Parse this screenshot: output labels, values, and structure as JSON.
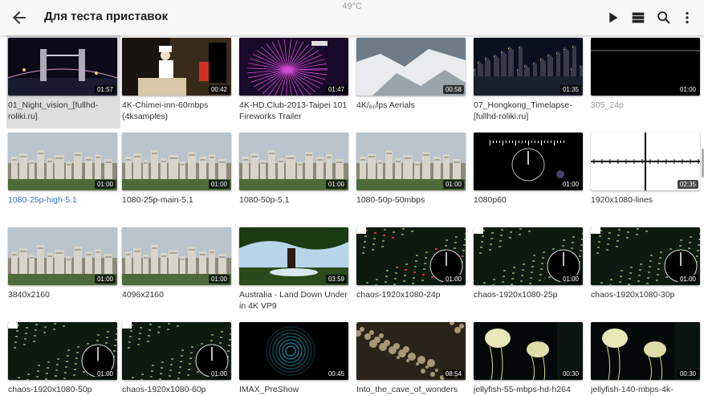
{
  "status_bar": {
    "temperature": "49°C"
  },
  "appbar": {
    "title": "Для теста приставок",
    "back_icon": "arrow-back-icon",
    "actions": [
      "play-icon",
      "list-view-icon",
      "search-icon",
      "more-vert-icon"
    ]
  },
  "videos": [
    {
      "name": "01_Night_vision_[fullhd-roliki.ru]",
      "duration": "01:57",
      "scene": "night-bridge",
      "selected": true
    },
    {
      "name": "4K-Chimei-inn-60mbps (4ksamples)",
      "duration": "00:42",
      "scene": "chef"
    },
    {
      "name": "4K-HD.Club-2013-Taipei 101 Fireworks Trailer",
      "duration": "01:47",
      "scene": "fireworks"
    },
    {
      "name": "4K/₆₀fps Aerials",
      "duration": "00:58",
      "scene": "snow"
    },
    {
      "name": "07_Hongkong_Timelapse-[fullhd-roliki.ru]",
      "duration": "01:35",
      "scene": "night-city"
    },
    {
      "name": "305_24p",
      "duration": "01:00",
      "scene": "black",
      "dimmed": true
    },
    {
      "name": "1080-25p-high-5.1",
      "duration": "01:00",
      "scene": "city",
      "highlight": true
    },
    {
      "name": "1080-25p-main-5.1",
      "duration": "01:00",
      "scene": "city"
    },
    {
      "name": "1080-50p-5.1",
      "duration": "01:00",
      "scene": "city"
    },
    {
      "name": "1080-50p-50mbps",
      "duration": "01:00",
      "scene": "city"
    },
    {
      "name": "1080p60",
      "duration": "01:00",
      "scene": "clock-dark"
    },
    {
      "name": "1920x1080-lines",
      "duration": "02:35",
      "scene": "lines"
    },
    {
      "name": "3840x2160",
      "duration": "01:00",
      "scene": "city"
    },
    {
      "name": "4096x2160",
      "duration": "01:00",
      "scene": "city"
    },
    {
      "name": "Australia - Land Down Under in 4K VP9",
      "duration": "03:59",
      "scene": "tree"
    },
    {
      "name": "chaos-1920x1080-24p",
      "duration": "01:00",
      "scene": "chaos-red"
    },
    {
      "name": "chaos-1920x1080-25p",
      "duration": "01:00",
      "scene": "chaos"
    },
    {
      "name": "chaos-1920x1080-30p",
      "duration": "01:00",
      "scene": "chaos"
    },
    {
      "name": "chaos-1920x1080-50p",
      "duration": "01:00",
      "scene": "chaos"
    },
    {
      "name": "chaos-1920x1080-60p",
      "duration": "01:00",
      "scene": "chaos"
    },
    {
      "name": "IMAX_PreShow",
      "duration": "00:45",
      "scene": "imax"
    },
    {
      "name": "Into_the_cave_of_wonders",
      "duration": "08:54",
      "scene": "cave"
    },
    {
      "name": "jellyfish-55-mbps-hd-h264",
      "duration": "00:30",
      "scene": "jellyfish"
    },
    {
      "name": "jellyfish-140-mbps-4k-",
      "duration": "00:30",
      "scene": "jellyfish"
    }
  ],
  "colors": {
    "appbar_bg": "#f7f7f7",
    "highlight_text": "#3b6fc4",
    "selected_bg": "#dedede"
  }
}
